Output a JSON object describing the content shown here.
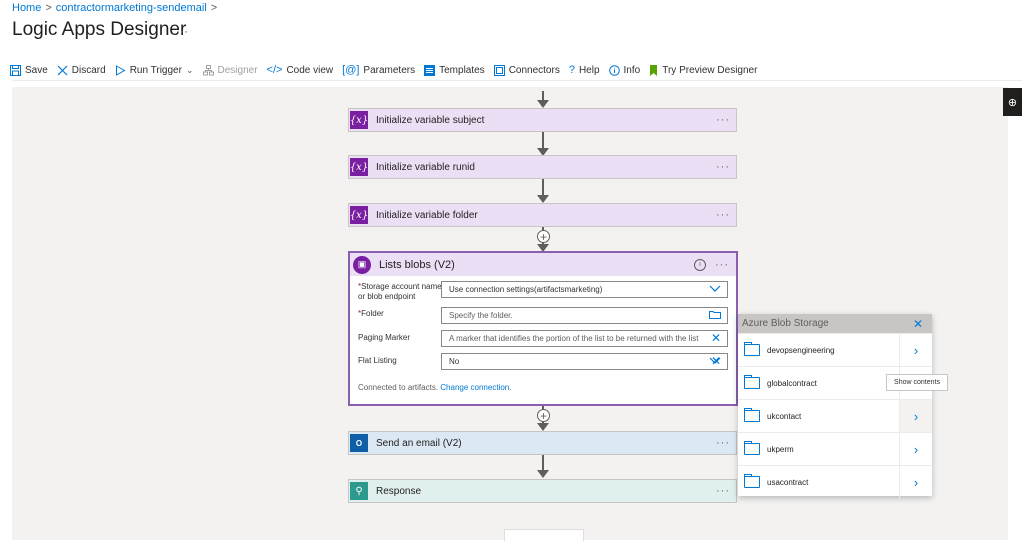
{
  "breadcrumb": {
    "home": "Home",
    "sep1": ">",
    "resource": "contractormarketing-sendemail",
    "sep2": ">"
  },
  "page": {
    "title": "Logic Apps Designer",
    "more": "···"
  },
  "toolbar": {
    "save": "Save",
    "discard": "Discard",
    "run_trigger": "Run Trigger",
    "designer": "Designer",
    "code_view": "Code view",
    "parameters": "Parameters",
    "templates": "Templates",
    "connectors": "Connectors",
    "help": "Help",
    "info": "Info",
    "try_preview": "Try Preview Designer"
  },
  "steps": {
    "init_subject": "Initialize variable subject",
    "init_runid": "Initialize variable runid",
    "init_folder": "Initialize variable folder",
    "send_email": "Send an email (V2)",
    "response": "Response",
    "more": "···",
    "var_icon": "{x}"
  },
  "list_blobs": {
    "title": "Lists blobs (V2)",
    "storage_label_1": "Storage account name",
    "storage_label_2": "or blob endpoint",
    "storage_value": "Use connection settings(artifactsmarketing)",
    "folder_label": "Folder",
    "folder_placeholder": "Specify the folder.",
    "paging_label": "Paging Marker",
    "paging_placeholder": "A marker that identifies the portion of the list to be returned with the list",
    "flat_label": "Flat Listing",
    "flat_value": "No",
    "connected_text": "Connected to artifacts.",
    "change_connection": "Change connection.",
    "required_mark": "*"
  },
  "picker": {
    "title": "Azure Blob Storage",
    "items": [
      "devopsengineering",
      "globalcontract",
      "ukcontact",
      "ukperm",
      "usacontract"
    ],
    "tooltip": "Show contents"
  },
  "colors": {
    "accent": "#0078d4",
    "variable": "#7a1fa2",
    "email": "#0f5fa8",
    "response": "#2e9a8e"
  }
}
